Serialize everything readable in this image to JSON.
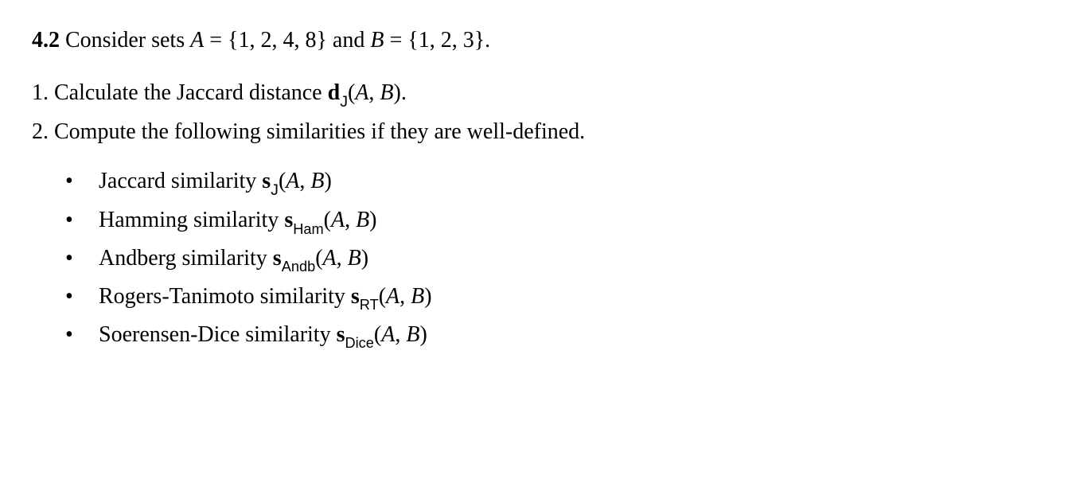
{
  "header": {
    "number": "4.2",
    "text_before_A": "Consider sets ",
    "set_A_name": "A",
    "eq1": " = ",
    "set_A_value": "{1, 2, 4, 8}",
    "and_text": " and ",
    "set_B_name": "B",
    "eq2": " = ",
    "set_B_value": "{1, 2, 3}",
    "period": "."
  },
  "items": {
    "1": {
      "num": "1.",
      "text": "Calculate the Jaccard distance ",
      "sym": "d",
      "sub": "J",
      "args": "(A, B)",
      "period": "."
    },
    "2": {
      "num": "2.",
      "text": "Compute the following similarities if they are well-defined."
    }
  },
  "bullets": {
    "b1": {
      "label": "Jaccard similarity ",
      "sym": "s",
      "sub": "J",
      "args": "(A, B)"
    },
    "b2": {
      "label": "Hamming similarity ",
      "sym": "s",
      "sub": "Ham",
      "args": "(A, B)"
    },
    "b3": {
      "label": "Andberg similarity ",
      "sym": "s",
      "sub": "Andb",
      "args": "(A, B)"
    },
    "b4": {
      "label": "Rogers-Tanimoto similarity ",
      "sym": "s",
      "sub": "RT",
      "args": "(A, B)"
    },
    "b5": {
      "label": "Soerensen-Dice similarity ",
      "sym": "s",
      "sub": "Dice",
      "args": "(A, B)"
    }
  }
}
